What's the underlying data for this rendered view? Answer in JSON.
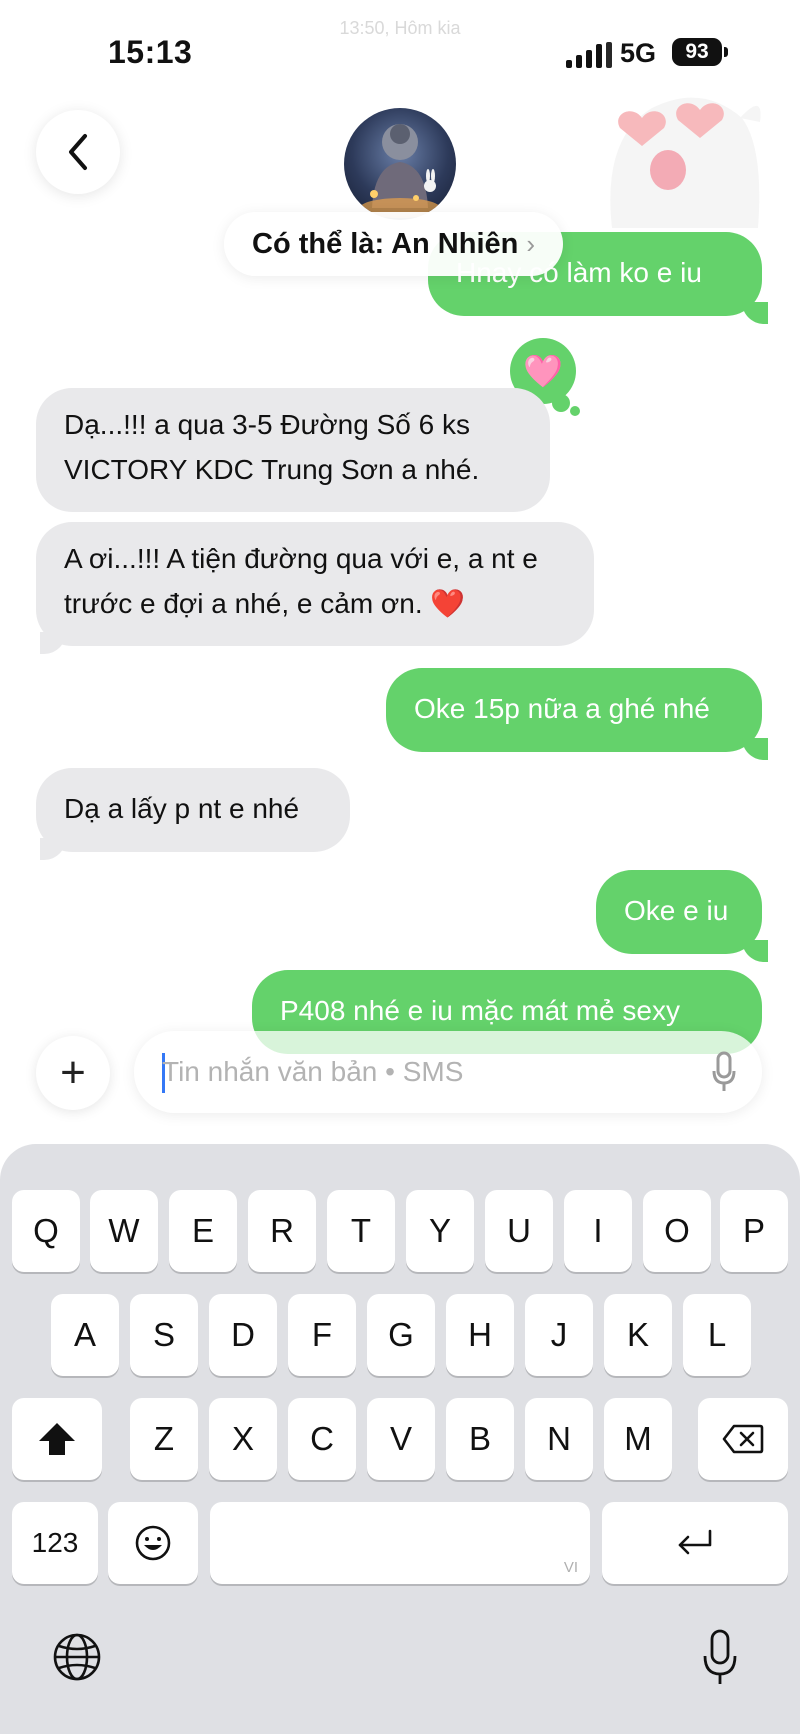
{
  "status": {
    "time": "15:13",
    "network": "5G",
    "battery": "93",
    "ghost_time": "13:50, Hôm kia"
  },
  "header": {
    "contact_label": "Có thể là: An Nhiên",
    "chevron": "›"
  },
  "messages": [
    {
      "dir": "out",
      "text": "Hnay có làm ko e iu"
    },
    {
      "dir": "in",
      "text": "Dạ...!!! a qua 3-5 Đường Số 6 ks VICTORY KDC Trung Sơn  a nhé."
    },
    {
      "dir": "in",
      "text": "A ơi...!!!  A tiện đường qua với e, a nt e trước e đợi a nhé, e cảm ơn. ❤️"
    },
    {
      "dir": "out",
      "text": "Oke 15p nữa a ghé nhé"
    },
    {
      "dir": "in",
      "text": "Dạ a lấy p nt e nhé"
    },
    {
      "dir": "out",
      "text": "Oke e iu"
    },
    {
      "dir": "out",
      "text": "P408 nhé e iu mặc mát mẻ sexy"
    }
  ],
  "reaction": "🩷",
  "composer": {
    "placeholder": "Tin nhắn văn bản • SMS",
    "plus": "+"
  },
  "keyboard": {
    "row1": [
      "Q",
      "W",
      "E",
      "R",
      "T",
      "Y",
      "U",
      "I",
      "O",
      "P"
    ],
    "row2": [
      "A",
      "S",
      "D",
      "F",
      "G",
      "H",
      "J",
      "K",
      "L"
    ],
    "row3": [
      "Z",
      "X",
      "C",
      "V",
      "B",
      "N",
      "M"
    ],
    "numbers_key": "123",
    "space_lang": "VI"
  },
  "colors": {
    "outgoing": "#64d26b",
    "incoming": "#e9e9eb",
    "keyboard_bg": "#dfe0e4"
  },
  "icons": [
    "back-chevron-icon",
    "shift-icon",
    "backspace-icon",
    "emoji-icon",
    "return-icon",
    "globe-icon",
    "mic-icon"
  ]
}
